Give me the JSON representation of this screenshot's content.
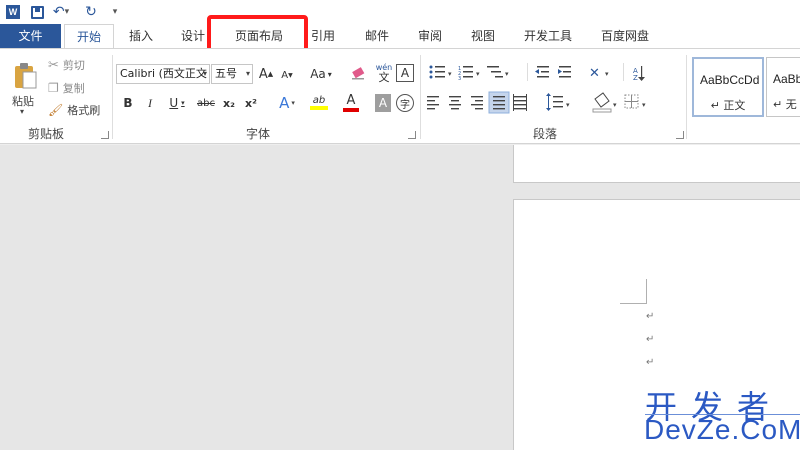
{
  "qat": {
    "word_logo": "W",
    "undo_glyph": "↶",
    "redo_glyph": "↻",
    "more_glyph": "▾",
    "icons": [
      "word-icon",
      "save-icon",
      "undo-icon",
      "redo-icon",
      "customize-icon"
    ]
  },
  "tabs": {
    "file": "文件",
    "home": "开始",
    "insert": "插入",
    "design": "设计",
    "layout": "页面布局",
    "references": "引用",
    "mailings": "邮件",
    "review": "审阅",
    "view": "视图",
    "developer": "开发工具",
    "baidu": "百度网盘"
  },
  "clipboard": {
    "paste": "粘贴",
    "cut": "剪切",
    "copy": "复制",
    "format_painter": "格式刷",
    "label": "剪贴板"
  },
  "font": {
    "font_name": "Calibri (西文正文",
    "font_size": "五号",
    "grow": "A",
    "shrink": "A",
    "change_case": "Aa",
    "bold": "B",
    "italic": "I",
    "underline": "U",
    "strike": "abc",
    "subscript": "x₂",
    "superscript": "x²",
    "text_effects": "A",
    "highlight": "ab",
    "font_color": "A",
    "char_shading": "A",
    "enclose": "字",
    "pinyin_top": "wén",
    "pinyin_bottom": "文",
    "border_char": "A",
    "label": "字体"
  },
  "paragraph": {
    "label": "段落"
  },
  "styles": {
    "normal_sample": "AaBbCcDd",
    "normal_name": "↵ 正文",
    "nospace_sample": "AaBb",
    "nospace_name": "↵ 无"
  },
  "document": {
    "para_marks": [
      "↵",
      "↵",
      "↵"
    ]
  },
  "watermark": {
    "cn": "开发者",
    "en": "DevZe.CoM"
  },
  "colors": {
    "accent": "#2b579a",
    "highlight_box": "#ff1a1a",
    "font_color_bar": "#e00000",
    "highlight_bar": "#ffff00",
    "watermark": "#2b59c3"
  }
}
